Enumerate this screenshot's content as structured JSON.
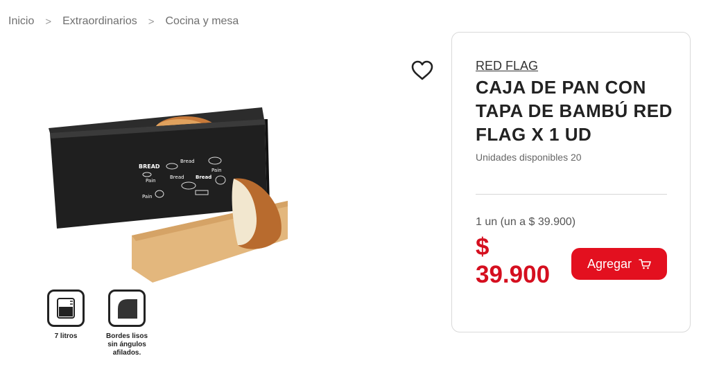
{
  "breadcrumb": {
    "items": [
      "Inicio",
      "Extraordinarios",
      "Cocina y mesa"
    ],
    "separator": ">"
  },
  "image": {
    "box_text": [
      "BREAD",
      "Bread",
      "Pain",
      "Bread",
      "Pain",
      "Pain",
      "Bread"
    ]
  },
  "features": [
    {
      "icon": "capacity-icon",
      "label": "7 litros"
    },
    {
      "icon": "rounded-edges-icon",
      "label": "Bordes lisos sin ángulos afilados."
    }
  ],
  "product": {
    "brand": "RED FLAG",
    "title": "CAJA DE PAN CON TAPA DE BAMBÚ RED FLAG X 1 UD",
    "stock": "Unidades disponibles 20",
    "unit_price": "1 un (un a $ 39.900)",
    "price_symbol": "$",
    "price_value": "39.900",
    "add_button_label": "Agregar"
  },
  "colors": {
    "accent": "#e3101f",
    "price": "#d50f1f"
  }
}
